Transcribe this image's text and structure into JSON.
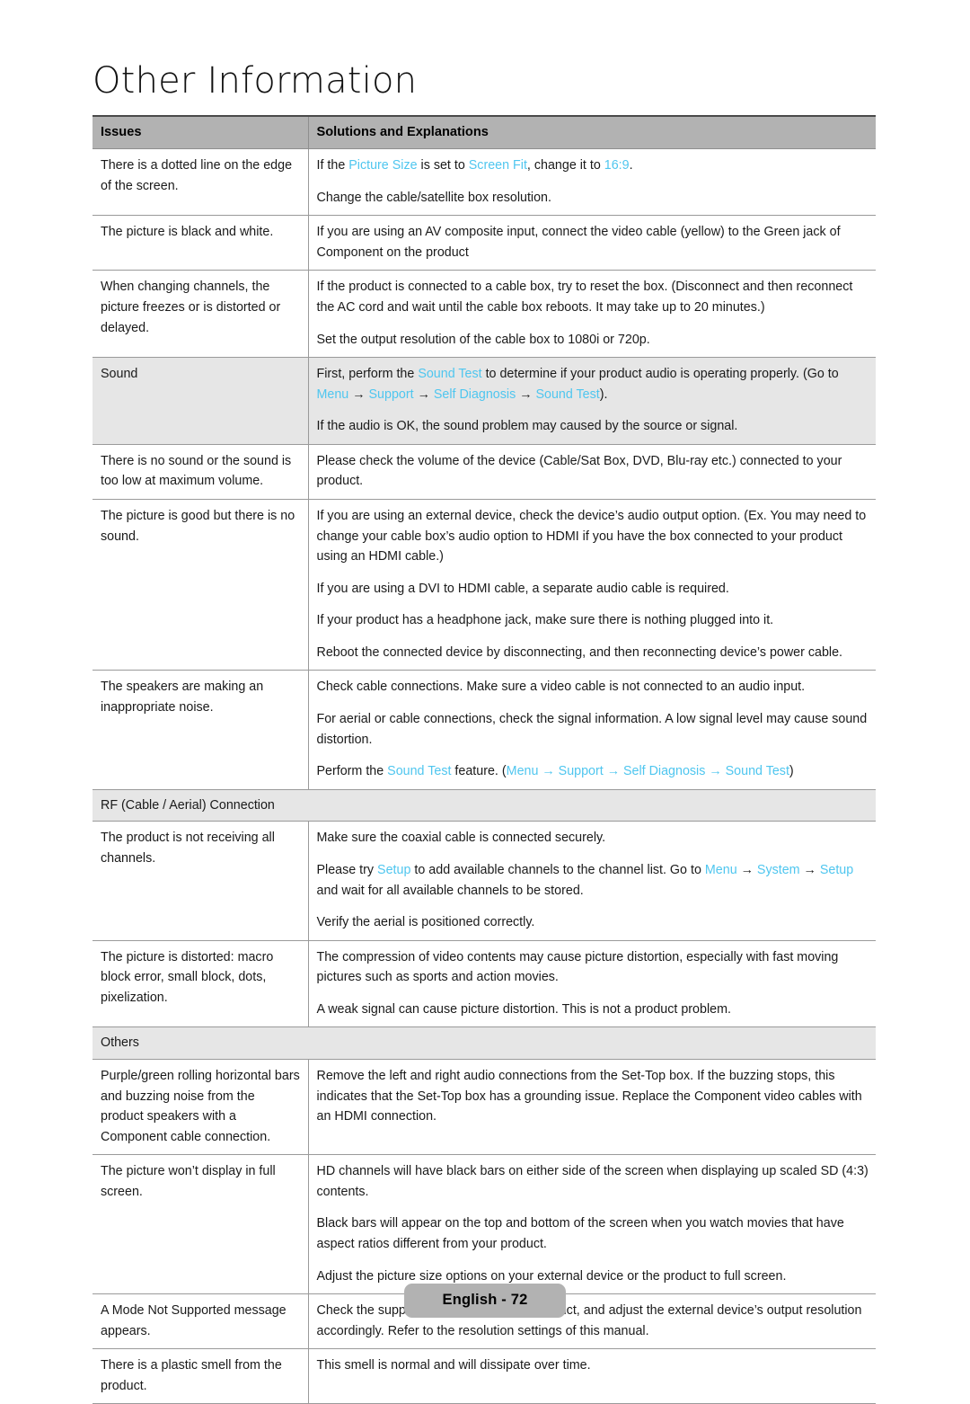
{
  "document": {
    "title": "Other Information",
    "footer_label": "English - 72",
    "accent_blue": "#4fc6ef",
    "header_gray": "#b2b2b2",
    "shade_gray": "#e6e6e6"
  },
  "table": {
    "headers": {
      "issues": "Issues",
      "solutions": "Solutions and Explanations"
    },
    "rows": [
      {
        "issue": "There is a dotted line on the edge of the screen.",
        "shaded": false,
        "paragraphs": [
          [
            {
              "t": "If the ",
              "s": "plain"
            },
            {
              "t": "Picture Size",
              "s": "blue"
            },
            {
              "t": " is set to ",
              "s": "plain"
            },
            {
              "t": "Screen Fit",
              "s": "blue"
            },
            {
              "t": ", change it to ",
              "s": "plain"
            },
            {
              "t": "16:9",
              "s": "blue"
            },
            {
              "t": ".",
              "s": "plain"
            }
          ],
          [
            {
              "t": "Change the cable/satellite box resolution.",
              "s": "plain"
            }
          ]
        ]
      },
      {
        "issue": "The picture is black and white.",
        "shaded": false,
        "paragraphs": [
          [
            {
              "t": "If you are using an AV composite input, connect the video cable (yellow) to the Green jack of Component on the product",
              "s": "plain"
            }
          ]
        ]
      },
      {
        "issue": "When changing channels, the picture freezes or is distorted or delayed.",
        "shaded": false,
        "paragraphs": [
          [
            {
              "t": "If the product is connected to a cable box, try to reset the box. (Disconnect and then reconnect the AC cord and wait until the cable box reboots. It may take up to 20 minutes.)",
              "s": "plain"
            }
          ],
          [
            {
              "t": "Set the output resolution of the cable box to 1080i or 720p.",
              "s": "plain"
            }
          ]
        ]
      },
      {
        "issue": "Sound",
        "shaded": true,
        "paragraphs": [
          [
            {
              "t": "First, perform the ",
              "s": "plain"
            },
            {
              "t": "Sound Test",
              "s": "blue"
            },
            {
              "t": " to determine if your product audio is operating properly. (Go to ",
              "s": "plain"
            },
            {
              "t": "Menu",
              "s": "blue"
            },
            {
              "t": " → ",
              "s": "plain"
            },
            {
              "t": "Support",
              "s": "blue"
            },
            {
              "t": " → ",
              "s": "plain"
            },
            {
              "t": "Self Diagnosis",
              "s": "blue"
            },
            {
              "t": " → ",
              "s": "plain"
            },
            {
              "t": "Sound Test",
              "s": "blue"
            },
            {
              "t": ").",
              "s": "plain"
            }
          ],
          [
            {
              "t": "If the audio is OK, the sound problem may caused by the source or signal.",
              "s": "plain"
            }
          ]
        ]
      },
      {
        "issue": "There is no sound or the sound is too low at maximum volume.",
        "shaded": false,
        "paragraphs": [
          [
            {
              "t": "Please check the volume of the device (Cable/Sat Box, DVD, Blu-ray etc.) connected to your product.",
              "s": "plain"
            }
          ]
        ]
      },
      {
        "issue": "The picture is good but there is no sound.",
        "shaded": false,
        "paragraphs": [
          [
            {
              "t": "If you are using an external device, check the device’s audio output option. (Ex. You may need to change your cable box’s audio option to HDMI if you have the box connected to your product using an HDMI cable.)",
              "s": "plain"
            }
          ],
          [
            {
              "t": "If you are using a DVI to HDMI cable, a separate audio cable is required.",
              "s": "plain"
            }
          ],
          [
            {
              "t": "If your product has a headphone jack, make sure there is nothing plugged into it.",
              "s": "plain"
            }
          ],
          [
            {
              "t": "Reboot the connected device by disconnecting, and then reconnecting device’s power cable.",
              "s": "plain"
            }
          ]
        ]
      },
      {
        "issue": "The speakers are making an inappropriate noise.",
        "shaded": false,
        "paragraphs": [
          [
            {
              "t": "Check cable connections. Make sure a video cable is not connected to an audio input.",
              "s": "plain"
            }
          ],
          [
            {
              "t": "For aerial or cable connections, check the signal information. A low signal level may cause sound distortion.",
              "s": "plain"
            }
          ],
          [
            {
              "t": "Perform the ",
              "s": "plain"
            },
            {
              "t": "Sound Test",
              "s": "blue"
            },
            {
              "t": " feature. (",
              "s": "plain"
            },
            {
              "t": "Menu",
              "s": "blue"
            },
            {
              "t": " → ",
              "s": "blue"
            },
            {
              "t": "Support",
              "s": "blue"
            },
            {
              "t": " → ",
              "s": "blue"
            },
            {
              "t": "Self Diagnosis",
              "s": "blue"
            },
            {
              "t": " → ",
              "s": "blue"
            },
            {
              "t": "Sound Test",
              "s": "blue"
            },
            {
              "t": ")",
              "s": "plain"
            }
          ]
        ]
      },
      {
        "section": "RF (Cable / Aerial) Connection"
      },
      {
        "issue": "The product is not receiving all channels.",
        "shaded": false,
        "paragraphs": [
          [
            {
              "t": "Make sure the coaxial cable is connected securely.",
              "s": "plain"
            }
          ],
          [
            {
              "t": "Please try ",
              "s": "plain"
            },
            {
              "t": "Setup",
              "s": "blue"
            },
            {
              "t": " to add available channels to the channel list. Go to ",
              "s": "plain"
            },
            {
              "t": "Menu",
              "s": "blue"
            },
            {
              "t": " → ",
              "s": "plain"
            },
            {
              "t": "System",
              "s": "blue"
            },
            {
              "t": " → ",
              "s": "plain"
            },
            {
              "t": "Setup",
              "s": "blue"
            },
            {
              "t": " and wait for all available channels to be stored.",
              "s": "plain"
            }
          ],
          [
            {
              "t": "Verify the aerial is positioned correctly.",
              "s": "plain"
            }
          ]
        ]
      },
      {
        "issue": "The picture is distorted: macro block error, small block, dots, pixelization.",
        "shaded": false,
        "paragraphs": [
          [
            {
              "t": "The compression of video contents may cause picture distortion, especially with fast moving pictures such as sports and action movies.",
              "s": "plain"
            }
          ],
          [
            {
              "t": "A weak signal can cause picture distortion. This is not a product problem.",
              "s": "plain"
            }
          ]
        ]
      },
      {
        "section": "Others"
      },
      {
        "issue": "Purple/green rolling horizontal bars and buzzing noise from the product speakers with a Component cable connection.",
        "shaded": false,
        "paragraphs": [
          [
            {
              "t": "Remove the left and right audio connections from the Set-Top box. If the buzzing stops, this indicates that the Set-Top box has a grounding issue. Replace the Component video cables with an HDMI connection.",
              "s": "plain"
            }
          ]
        ]
      },
      {
        "issue": "The picture won’t display in full screen.",
        "shaded": false,
        "paragraphs": [
          [
            {
              "t": "HD channels will have black bars on either side of the screen when displaying up scaled SD (4:3) contents.",
              "s": "plain"
            }
          ],
          [
            {
              "t": "Black bars will appear on the top and bottom of the screen when you watch movies that have aspect ratios different from your product.",
              "s": "plain"
            }
          ],
          [
            {
              "t": "Adjust the picture size options on your external device or the product to full screen.",
              "s": "plain"
            }
          ]
        ]
      },
      {
        "issue": "A Mode Not Supported message appears.",
        "shaded": false,
        "paragraphs": [
          [
            {
              "t": "Check the supported resolution of the product, and adjust the external device’s output resolution accordingly. Refer to the resolution settings of this manual.",
              "s": "plain"
            }
          ]
        ]
      },
      {
        "issue": "There is a plastic smell from the product.",
        "shaded": false,
        "paragraphs": [
          [
            {
              "t": "This smell is normal and will dissipate over time.",
              "s": "plain"
            }
          ]
        ]
      }
    ]
  }
}
